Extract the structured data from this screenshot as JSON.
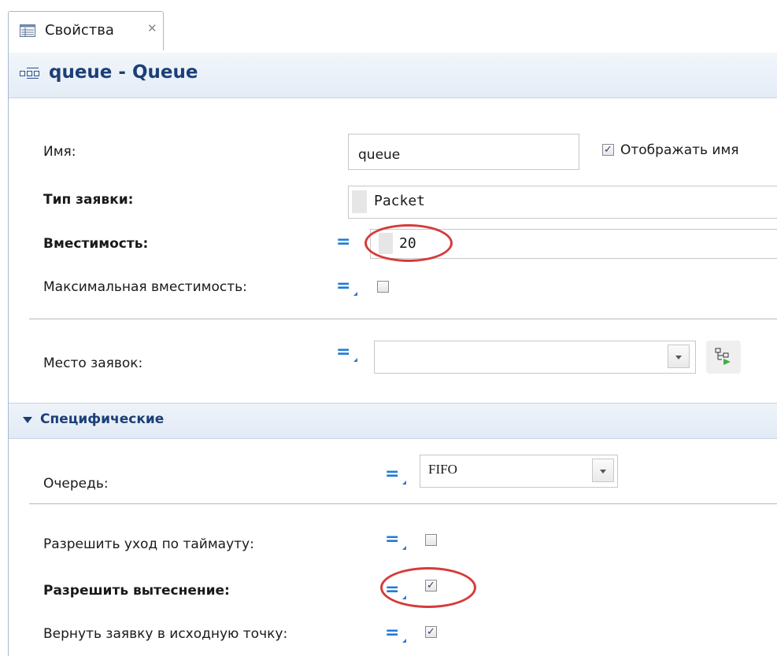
{
  "tab": {
    "label": "Свойства",
    "close_icon": "close-icon"
  },
  "header": {
    "title": "queue - Queue",
    "icon": "queue-icon"
  },
  "fields": {
    "name": {
      "label": "Имя:",
      "value": "queue",
      "show_name_label": "Отображать имя",
      "show_name_checked": true
    },
    "agent_type": {
      "label": "Тип заявки:",
      "value": "Packet"
    },
    "capacity": {
      "label": "Вместимость:",
      "value": "20"
    },
    "max_capacity": {
      "label": "Максимальная вместимость:",
      "checked": false
    },
    "agent_location": {
      "label": "Место заявок:",
      "value": ""
    }
  },
  "section": {
    "label": "Специфические",
    "queue": {
      "label": "Очередь:",
      "value": "FIFO"
    },
    "timeout": {
      "label": "Разрешить уход по таймауту:",
      "checked": false
    },
    "preemption": {
      "label": "Разрешить вытеснение:",
      "checked": true
    },
    "return_agent": {
      "label": "Вернуть заявку в исходную точку:",
      "checked": true
    }
  },
  "colors": {
    "accent": "#1b3f77",
    "highlight": "#d63b3b",
    "equals": "#1f7bd6"
  }
}
